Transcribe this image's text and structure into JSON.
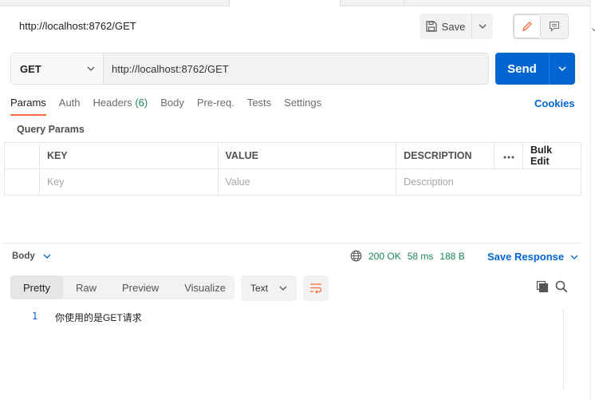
{
  "request": {
    "title": "http://localhost:8762/GET",
    "method": "GET",
    "url": "http://localhost:8762/GET",
    "save_label": "Save",
    "send_label": "Send"
  },
  "request_tabs": [
    {
      "label": "Params",
      "active": true
    },
    {
      "label": "Auth"
    },
    {
      "label": "Headers",
      "count": "(6)"
    },
    {
      "label": "Body"
    },
    {
      "label": "Pre-req."
    },
    {
      "label": "Tests"
    },
    {
      "label": "Settings"
    }
  ],
  "cookies_label": "Cookies",
  "query_params": {
    "title": "Query Params",
    "columns": [
      "KEY",
      "VALUE",
      "DESCRIPTION"
    ],
    "bulk_edit_label": "Bulk Edit",
    "placeholders": {
      "key": "Key",
      "value": "Value",
      "description": "Description"
    }
  },
  "response": {
    "body_label": "Body",
    "status": "200 OK",
    "time": "58 ms",
    "size": "188 B",
    "save_response_label": "Save Response",
    "view_tabs": [
      "Pretty",
      "Raw",
      "Preview",
      "Visualize"
    ],
    "active_view": "Pretty",
    "format": "Text",
    "lines": [
      {
        "no": "1",
        "text": "你使用的是GET请求"
      }
    ]
  },
  "colors": {
    "accent": "#0265d2",
    "active_tab": "#ff6c37",
    "status_ok": "#198754"
  }
}
